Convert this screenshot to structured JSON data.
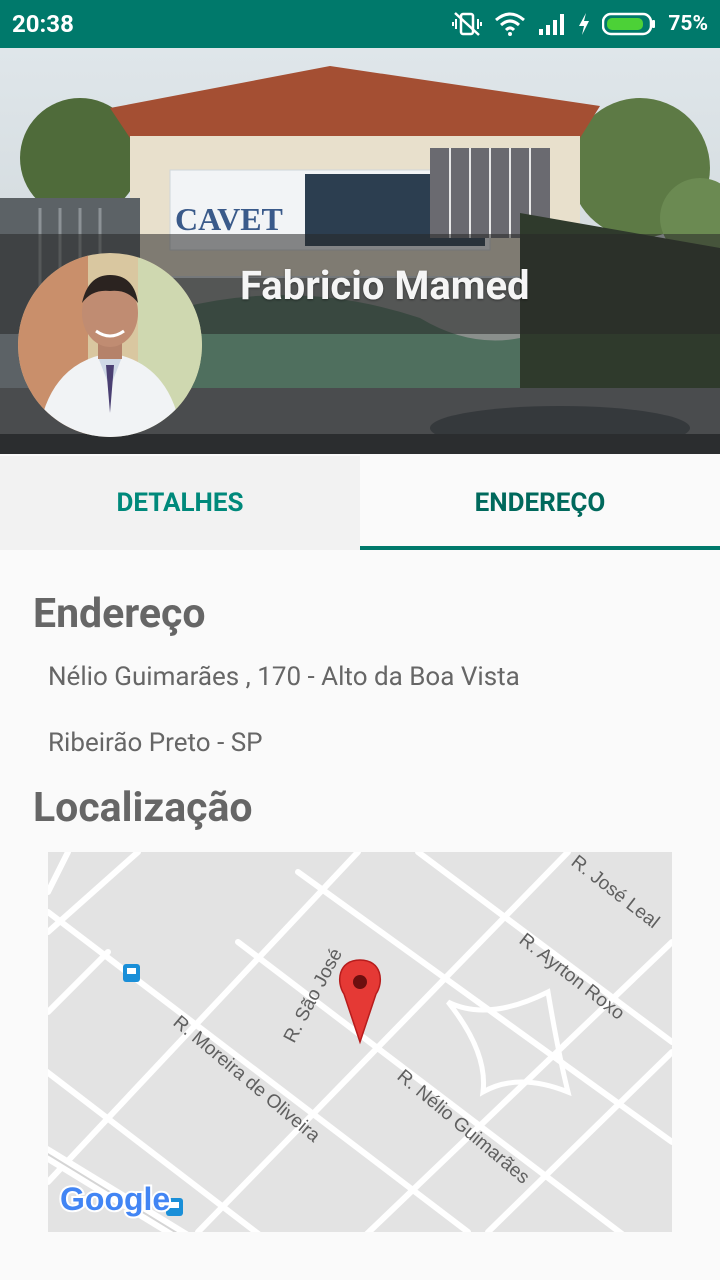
{
  "status_bar": {
    "time": "20:38",
    "battery_percent": "75%",
    "icons": [
      "vibrate-off-icon",
      "wifi-icon",
      "signal-icon",
      "charging-icon",
      "battery-icon"
    ]
  },
  "header": {
    "doctor_name": "Fabricio Mamed",
    "avatar": "doctor-photo"
  },
  "tabs": [
    {
      "label": "DETALHES",
      "active": false
    },
    {
      "label": "ENDEREÇO",
      "active": true
    }
  ],
  "address": {
    "title": "Endereço",
    "line1": "Nélio Guimarães , 170 - Alto da Boa Vista",
    "line2": "Ribeirão Preto - SP"
  },
  "location": {
    "title": "Localização",
    "map": {
      "streets": [
        "R. José Leal",
        "R. Ayrton Roxo",
        "R. São José",
        "R. Moreira de Oliveira",
        "R. Nélio Guimarães"
      ],
      "provider": "Google",
      "icons": [
        "map-pin-icon",
        "bus-stop-icon"
      ]
    }
  },
  "colors": {
    "primary": "#00796b",
    "accent": "#00897b",
    "text_gray": "#666666",
    "pin_red": "#e53935"
  }
}
